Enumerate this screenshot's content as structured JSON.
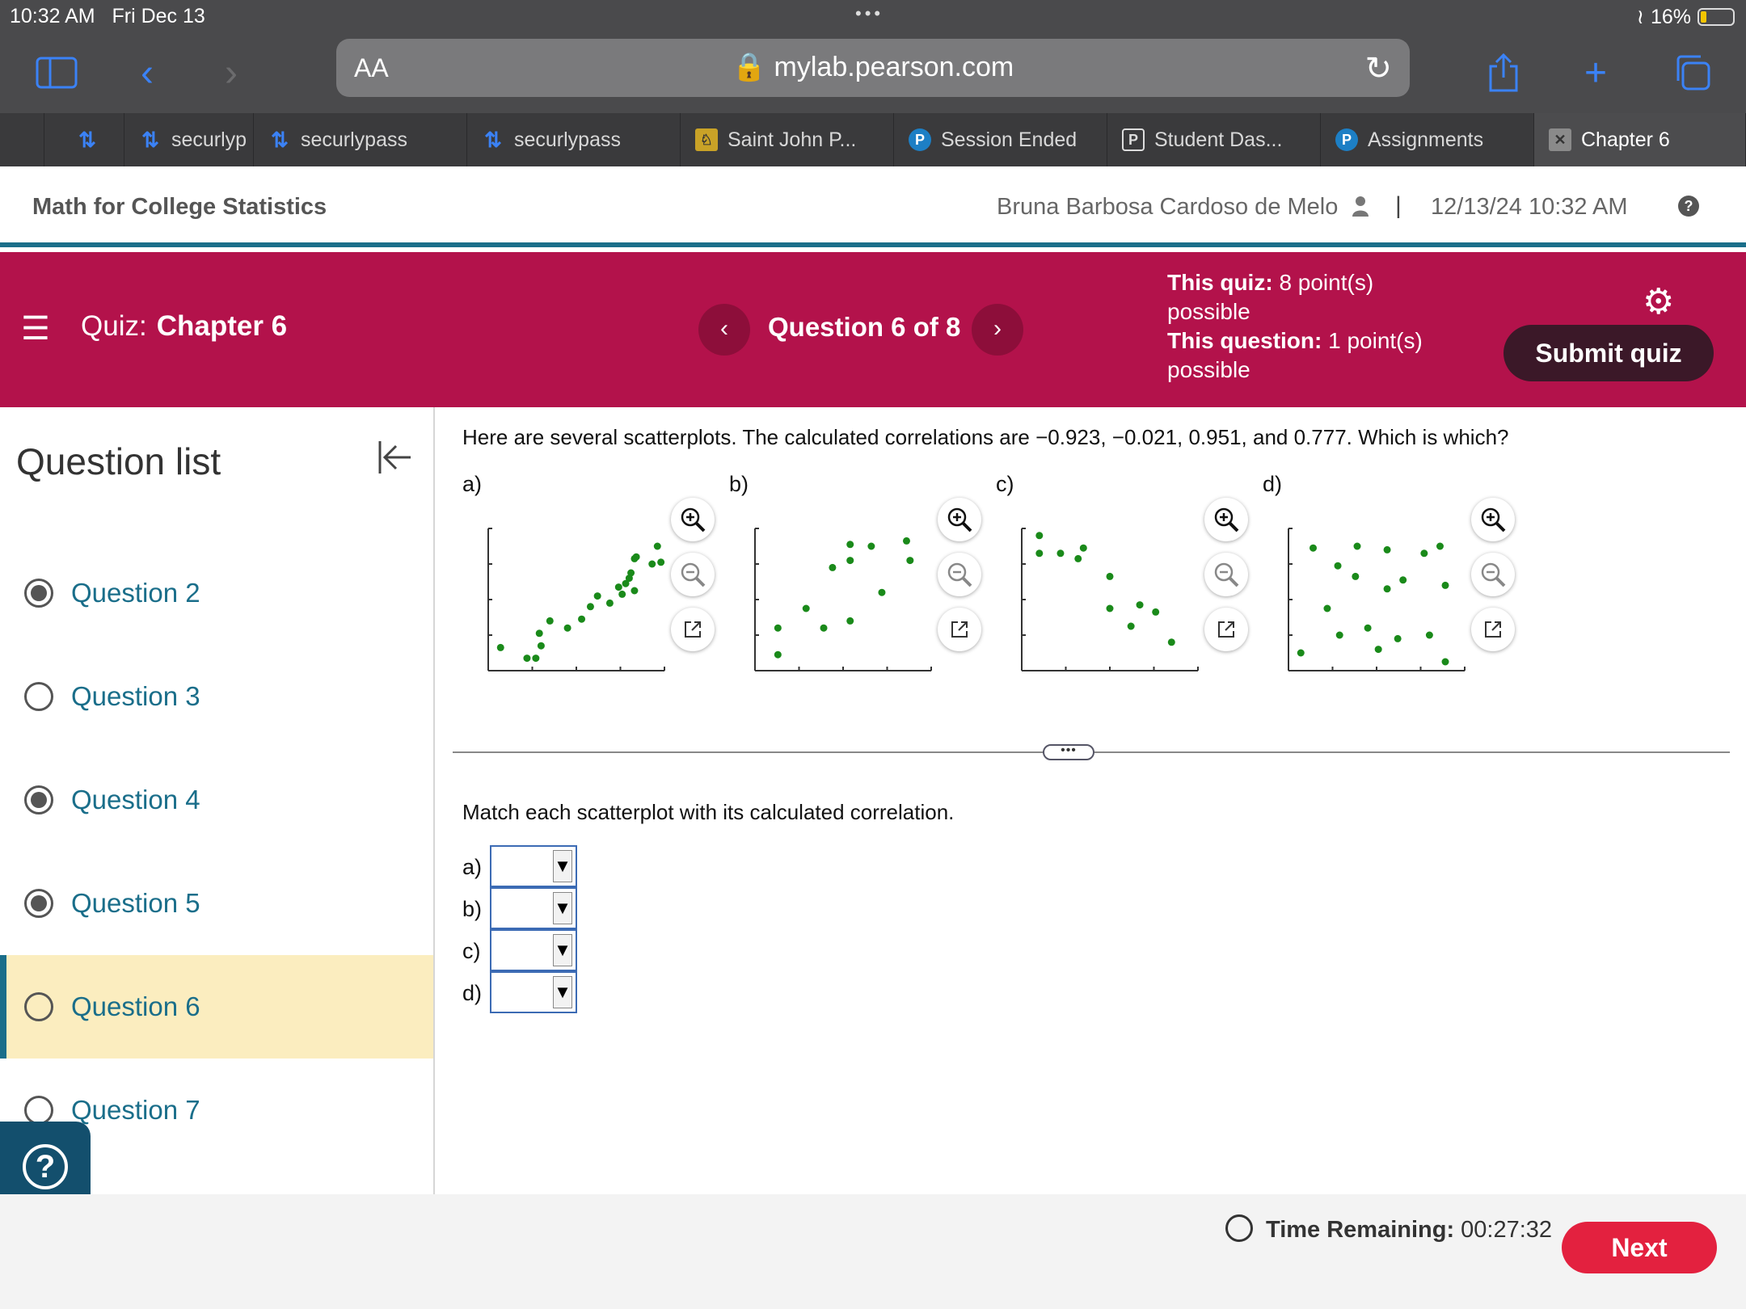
{
  "status_bar": {
    "time": "10:32 AM",
    "date": "Fri Dec 13",
    "battery": "16%",
    "battery_level_pct": 16
  },
  "browser": {
    "aa_label": "AA",
    "url": "mylab.pearson.com",
    "tabs": [
      {
        "label": "securlyp",
        "icon": "link-icon"
      },
      {
        "label": "securlypass",
        "icon": "link-icon"
      },
      {
        "label": "securlypass",
        "icon": "link-icon"
      },
      {
        "label": "Saint John P...",
        "icon": "shield-icon"
      },
      {
        "label": "Session Ended",
        "icon": "pearson-icon"
      },
      {
        "label": "Student Das...",
        "icon": "p-square-icon"
      },
      {
        "label": "Assignments",
        "icon": "pearson-icon"
      },
      {
        "label": "Chapter 6",
        "icon": "close-tab-icon"
      }
    ]
  },
  "header": {
    "course": "Math for College Statistics",
    "user": "Bruna Barbosa Cardoso de Melo",
    "separator": "|",
    "datetime": "12/13/24 10:32 AM",
    "help_glyph": "?"
  },
  "quiz_bar": {
    "quiz_prefix": "Quiz:",
    "quiz_name": "Chapter 6",
    "question_position": "Question 6 of 8",
    "quiz_points_label": "This quiz:",
    "quiz_points_value": "8 point(s) possible",
    "question_points_label": "This question:",
    "question_points_value": "1 point(s) possible",
    "submit_label": "Submit quiz",
    "accent_color": "#b3124b"
  },
  "sidebar": {
    "title": "Question list",
    "items": [
      {
        "label": "Question 2",
        "answered": true,
        "current": false
      },
      {
        "label": "Question 3",
        "answered": false,
        "current": false
      },
      {
        "label": "Question 4",
        "answered": true,
        "current": false
      },
      {
        "label": "Question 5",
        "answered": true,
        "current": false
      },
      {
        "label": "Question 6",
        "answered": false,
        "current": true
      },
      {
        "label": "Question 7",
        "answered": false,
        "current": false
      }
    ]
  },
  "question": {
    "prompt": "Here are several scatterplots. The calculated correlations are  −0.923,  −0.021, 0.951, and 0.777. Which is which?",
    "plot_labels": [
      "a)",
      "b)",
      "c)",
      "d)"
    ],
    "match_instruction": "Match each scatterplot with its calculated correlation.",
    "answer_rows": [
      {
        "label": "a)",
        "selected": ""
      },
      {
        "label": "b)",
        "selected": ""
      },
      {
        "label": "c)",
        "selected": ""
      },
      {
        "label": "d)",
        "selected": ""
      }
    ]
  },
  "chart_data": [
    {
      "type": "scatter",
      "title": "a)",
      "points": [
        [
          0.7,
          1.3
        ],
        [
          2.2,
          0.7
        ],
        [
          2.7,
          0.7
        ],
        [
          3.0,
          1.4
        ],
        [
          2.9,
          2.1
        ],
        [
          3.5,
          2.8
        ],
        [
          4.5,
          2.4
        ],
        [
          5.3,
          2.9
        ],
        [
          5.8,
          3.6
        ],
        [
          6.2,
          4.2
        ],
        [
          6.9,
          3.8
        ],
        [
          7.4,
          4.7
        ],
        [
          8.1,
          5.5
        ],
        [
          7.8,
          4.9
        ],
        [
          8.3,
          4.5
        ],
        [
          7.6,
          4.3
        ],
        [
          8.3,
          6.3
        ],
        [
          9.6,
          7.0
        ],
        [
          9.8,
          6.1
        ],
        [
          8.4,
          6.4
        ],
        [
          8.0,
          5.2
        ],
        [
          9.3,
          6.0
        ]
      ]
    },
    {
      "type": "scatter",
      "title": "b)",
      "points": [
        [
          1.3,
          0.9
        ],
        [
          1.3,
          2.4
        ],
        [
          2.9,
          3.5
        ],
        [
          3.9,
          2.4
        ],
        [
          4.4,
          5.8
        ],
        [
          5.4,
          6.2
        ],
        [
          5.4,
          7.1
        ],
        [
          5.4,
          2.8
        ],
        [
          6.6,
          7.0
        ],
        [
          7.2,
          4.4
        ],
        [
          8.6,
          7.3
        ],
        [
          8.8,
          6.2
        ]
      ]
    },
    {
      "type": "scatter",
      "title": "c)",
      "points": [
        [
          1.0,
          7.6
        ],
        [
          1.0,
          6.6
        ],
        [
          2.2,
          6.6
        ],
        [
          3.2,
          6.3
        ],
        [
          3.5,
          6.9
        ],
        [
          5.0,
          5.3
        ],
        [
          5.0,
          3.5
        ],
        [
          6.2,
          2.5
        ],
        [
          6.7,
          3.7
        ],
        [
          7.6,
          3.3
        ],
        [
          8.5,
          1.6
        ]
      ]
    },
    {
      "type": "scatter",
      "title": "d)",
      "points": [
        [
          0.7,
          1.0
        ],
        [
          1.4,
          6.9
        ],
        [
          2.2,
          3.5
        ],
        [
          2.9,
          2.0
        ],
        [
          2.8,
          5.9
        ],
        [
          3.8,
          5.3
        ],
        [
          3.9,
          7.0
        ],
        [
          4.5,
          2.4
        ],
        [
          5.1,
          1.2
        ],
        [
          5.6,
          4.6
        ],
        [
          5.6,
          6.8
        ],
        [
          6.2,
          1.8
        ],
        [
          6.5,
          5.1
        ],
        [
          7.7,
          6.6
        ],
        [
          8.0,
          2.0
        ],
        [
          8.6,
          7.0
        ],
        [
          8.9,
          4.8
        ],
        [
          8.9,
          0.5
        ]
      ]
    }
  ],
  "footer": {
    "timer_label": "Time Remaining:",
    "timer_value": "00:27:32",
    "next_label": "Next"
  }
}
